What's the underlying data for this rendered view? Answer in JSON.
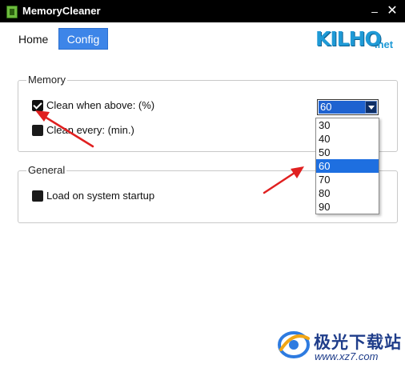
{
  "window": {
    "title": "MemoryCleaner",
    "minimize_glyph": "–",
    "close_glyph": "✕"
  },
  "nav": {
    "home_label": "Home",
    "config_label": "Config",
    "active": "Config"
  },
  "logo": {
    "main": "KILHO",
    "suffix": ".net"
  },
  "memory_group": {
    "legend": "Memory",
    "clean_when_above": {
      "label": "Clean when above: (%)",
      "checked": true
    },
    "clean_every": {
      "label": "Clean every: (min.)",
      "checked": false
    },
    "threshold_select": {
      "value": "60",
      "options": [
        "30",
        "40",
        "50",
        "60",
        "70",
        "80",
        "90"
      ],
      "selected_index": 3,
      "open": true
    }
  },
  "general_group": {
    "legend": "General",
    "load_on_startup": {
      "label": "Load on system startup",
      "checked": false
    }
  },
  "watermark": {
    "title": "极光下载站",
    "url": "www.xz7.com"
  },
  "colors": {
    "accent": "#3d85e8",
    "selection": "#1e6fe0",
    "annotation_arrow": "#e02020",
    "titlebar": "#000000"
  }
}
